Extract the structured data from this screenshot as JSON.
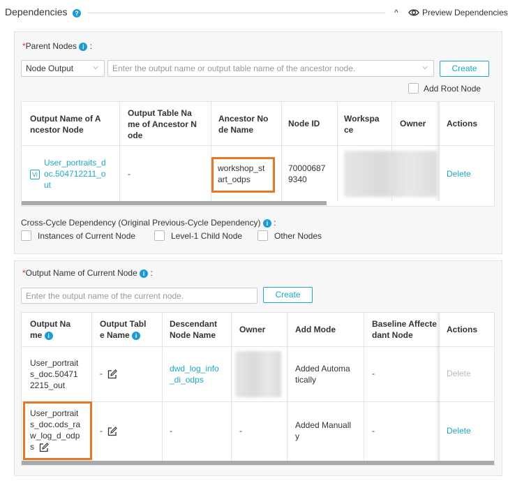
{
  "header": {
    "title": "Dependencies",
    "help_glyph": "?",
    "collapse_glyph": "^",
    "preview_label": "Preview Dependencies"
  },
  "parent": {
    "label": "Parent Nodes",
    "suffix": ":",
    "required": "*",
    "select_value": "Node Output",
    "input_placeholder": "Enter the output name or output table name of the ancestor node.",
    "create_label": "Create",
    "add_root_label": "Add Root Node",
    "table": {
      "headers": {
        "output_name_1": "Output Name of A",
        "output_name_2": "ncestor Node",
        "table_name_1": "Output Table Na",
        "table_name_2": "me of Ancestor N",
        "table_name_3": "ode",
        "ancestor_1": "Ancestor No",
        "ancestor_2": "de Name",
        "node_id": "Node ID",
        "workspace_1": "Workspa",
        "workspace_2": "ce",
        "owner": "Owner",
        "actions": "Actions"
      },
      "row": {
        "badge": "Vi",
        "output_1": "User_portraits_d",
        "output_2": "oc.504712211_o",
        "output_3": "ut",
        "table_name": "-",
        "ancestor_1": "workshop_st",
        "ancestor_2": "art_odps",
        "node_id_1": "70000687",
        "node_id_2": "9340",
        "action": "Delete"
      }
    }
  },
  "cross_cycle": {
    "label": "Cross-Cycle Dependency (Original Previous-Cycle Dependency)",
    "suffix": ":",
    "options": [
      "Instances of Current Node",
      "Level-1 Child Node",
      "Other Nodes"
    ]
  },
  "current": {
    "label": "Output Name of Current Node",
    "suffix": ":",
    "required": "*",
    "input_placeholder": "Enter the output name of the current node.",
    "create_label": "Create",
    "table": {
      "headers": {
        "output_1": "Output Na",
        "output_2": "me",
        "table_1": "Output Tabl",
        "table_2": "e Name",
        "desc_1": "Descendant",
        "desc_2": "Node Name",
        "owner": "Owner",
        "add_mode": "Add Mode",
        "baseline_1": "Baseline Affecte",
        "baseline_2": "dant Node",
        "actions": "Actions"
      },
      "rows": [
        {
          "output_1": "User_portrait",
          "output_2": "s_doc.50471",
          "output_3": "2215_out",
          "table": "-",
          "desc_1": "dwd_log_info",
          "desc_2": "_di_odps",
          "add_mode_1": "Added Automa",
          "add_mode_2": "tically",
          "baseline": "-",
          "action": "Delete"
        },
        {
          "output_1": "User_portrait",
          "output_2": "s_doc.ods_ra",
          "output_3": "w_log_d_odp",
          "output_4": "s",
          "table": "-",
          "desc": "-",
          "owner": "-",
          "add_mode_1": "Added Manuall",
          "add_mode_2": "y",
          "baseline": "-",
          "action": "Delete"
        }
      ]
    }
  },
  "colors": {
    "accent": "#1ba8c6",
    "highlight": "#e87722",
    "required": "#e0301e",
    "info": "#1a9bd7"
  }
}
